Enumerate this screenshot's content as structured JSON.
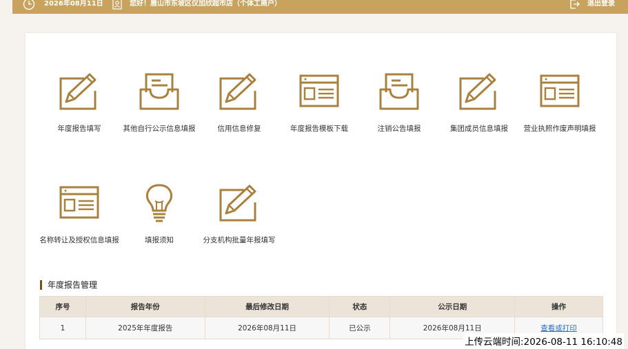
{
  "header": {
    "date": "2026年08月11日",
    "greeting": "您好！眉山市东坡区仪加欣超市店（个体工商户）",
    "logout": "退出登录"
  },
  "tiles": [
    {
      "label": "年度报告填写",
      "icon": "pencil-board-icon"
    },
    {
      "label": "其他自行公示信息填报",
      "icon": "inbox-tray-icon"
    },
    {
      "label": "信用信息修复",
      "icon": "pencil-board-icon"
    },
    {
      "label": "年度报告模板下载",
      "icon": "browser-window-icon"
    },
    {
      "label": "注销公告填报",
      "icon": "inbox-tray-icon"
    },
    {
      "label": "集团成员信息填报",
      "icon": "pencil-board-icon"
    },
    {
      "label": "营业执照作废声明填报",
      "icon": "browser-window-icon"
    },
    {
      "label": "名称转让及授权信息填报",
      "icon": "browser-window-icon"
    },
    {
      "label": "填报须知",
      "icon": "lightbulb-icon"
    },
    {
      "label": "分支机构批量年报填写",
      "icon": "pencil-board-icon"
    }
  ],
  "section": {
    "title": "年度报告管理"
  },
  "table": {
    "headers": [
      "序号",
      "报告年份",
      "最后修改日期",
      "状态",
      "公示日期",
      "操作"
    ],
    "rows": [
      [
        "1",
        "2025年年度报告",
        "2026年08月11日",
        "已公示",
        "2026年08月11日",
        "查看或打印"
      ]
    ]
  },
  "footer": {
    "upload_time": "上传云端时间:2026-08-11 16:10:48"
  },
  "colors": {
    "accent": "#c8a35e",
    "icon": "#a8813f",
    "section_bar": "#7a4e1d",
    "table_header": "#ece4d9",
    "link": "#2a6fbf"
  }
}
